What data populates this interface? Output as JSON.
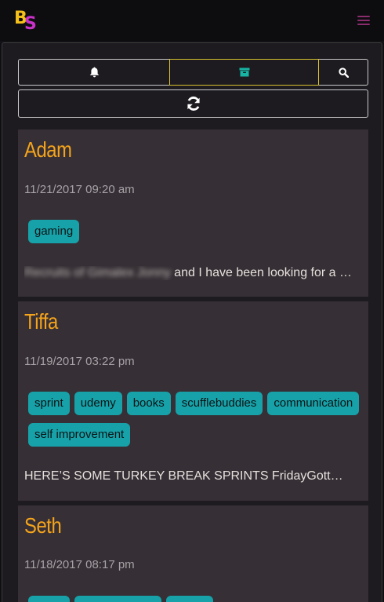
{
  "nav": {
    "logo_letters": [
      "B",
      "S"
    ]
  },
  "toolbar": {
    "buttons": [
      {
        "icon": "bell-icon",
        "active": false
      },
      {
        "icon": "archive-icon",
        "active": true
      },
      {
        "icon": "search-icon",
        "active": false
      }
    ],
    "refresh_icon": "refresh-icon"
  },
  "colors": {
    "accent": "#f5a41b",
    "tag": "#17a2a9",
    "active_border": "#d8c12e",
    "card": "#362f35"
  },
  "cards": [
    {
      "name": "Adam",
      "date": "11/21/2017 09:20 am",
      "tags": [
        "gaming"
      ],
      "excerpt_blurred": "Recruits of Gimalex Jonny",
      "excerpt": " and I have been looking for a …"
    },
    {
      "name": "Tiffa",
      "date": "11/19/2017 03:22 pm",
      "tags": [
        "sprint",
        "udemy",
        "books",
        "scufflebuddies",
        "communication",
        "self improvement"
      ],
      "excerpt_blurred": "",
      "excerpt": "HERE’S SOME TURKEY BREAK SPRINTS FridayGott…"
    },
    {
      "name": "Seth",
      "date": "11/18/2017 08:17 pm",
      "tags": [
        "",
        "",
        ""
      ],
      "excerpt_blurred": "",
      "excerpt": ""
    }
  ]
}
